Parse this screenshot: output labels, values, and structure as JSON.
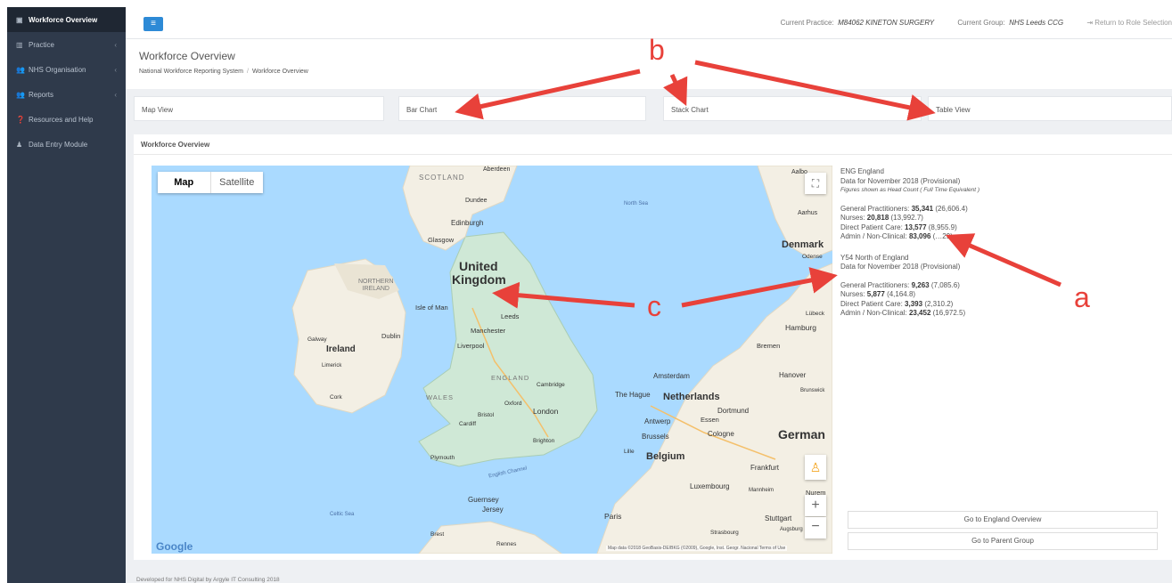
{
  "sidebar": {
    "items": [
      {
        "icon": "monitor-icon",
        "glyph": "▣",
        "label": "Workforce Overview",
        "chevron": ""
      },
      {
        "icon": "chart-icon",
        "glyph": "▥",
        "label": "Practice",
        "chevron": "‹"
      },
      {
        "icon": "users-icon",
        "glyph": "👥",
        "label": "NHS Organisation",
        "chevron": "‹"
      },
      {
        "icon": "users-icon",
        "glyph": "👥",
        "label": "Reports",
        "chevron": "‹"
      },
      {
        "icon": "help-icon",
        "glyph": "❓",
        "label": "Resources and Help",
        "chevron": ""
      },
      {
        "icon": "user-icon",
        "glyph": "♟",
        "label": "Data Entry Module",
        "chevron": ""
      }
    ]
  },
  "topbar": {
    "practice_label": "Current Practice:",
    "practice_value": "M84062 KINETON SURGERY",
    "group_label": "Current Group:",
    "group_value": "NHS Leeds CCG",
    "return_label": "Return to Role Selection"
  },
  "header": {
    "title": "Workforce Overview",
    "breadcrumb": [
      "National Workforce Reporting System",
      "Workforce Overview"
    ]
  },
  "tabs": [
    "Map View",
    "Bar Chart",
    "Stack Chart",
    "Table View"
  ],
  "panel": {
    "title": "Workforce Overview"
  },
  "map": {
    "toggle_map": "Map",
    "toggle_satellite": "Satellite",
    "zoom_in": "+",
    "zoom_out": "−",
    "google": "Google",
    "attribution": "Map data ©2018 GeoBasis-DE/BKG (©2009), Google, Inst. Geogr. Nacional  Terms of Use",
    "labels": {
      "scotland": "SCOTLAND",
      "aberdeen": "Aberdeen",
      "dundee": "Dundee",
      "edinburgh": "Edinburgh",
      "glasgow": "Glasgow",
      "north_sea": "North Sea",
      "united": "United",
      "kingdom": "Kingdom",
      "northern_ireland": "NORTHERN\nIRELAND",
      "isle_of_man": "Isle of Man",
      "leeds": "Leeds",
      "manchester": "Manchester",
      "liverpool": "Liverpool",
      "dublin": "Dublin",
      "galway": "Galway",
      "ireland": "Ireland",
      "limerick": "Limerick",
      "cork": "Cork",
      "wales": "WALES",
      "england": "ENGLAND",
      "cambridge": "Cambridge",
      "oxford": "Oxford",
      "london": "London",
      "bristol": "Bristol",
      "cardiff": "Cardiff",
      "brighton": "Brighton",
      "plymouth": "Plymouth",
      "english_channel": "English Channel",
      "guernsey": "Guernsey",
      "jersey": "Jersey",
      "celtic_sea": "Celtic Sea",
      "aalborg": "Aalbo",
      "aarhus": "Aarhus",
      "denmark": "Denmark",
      "odense": "Odense",
      "lubeck": "Lübeck",
      "hamburg": "Hamburg",
      "bremen": "Bremen",
      "amsterdam": "Amsterdam",
      "the_hague": "The Hague",
      "netherlands": "Netherlands",
      "hanover": "Hanover",
      "brunswick": "Brunswick",
      "dortmund": "Dortmund",
      "essen": "Essen",
      "antwerp": "Antwerp",
      "cologne": "Cologne",
      "brussels": "Brussels",
      "belgium": "Belgium",
      "germany": "German",
      "frankfurt": "Frankfurt",
      "luxembourg": "Luxembourg",
      "mannheim": "Mannheim",
      "nurem": "Nurem",
      "paris": "Paris",
      "stuttgart": "Stuttgart",
      "strasbourg": "Strasbourg",
      "augsburg": "Augsburg",
      "lille": "Lille",
      "brest": "Brest",
      "rennes": "Rennes"
    }
  },
  "info": {
    "eng": {
      "code": "ENG England",
      "period": "Data for November 2018 (Provisional)",
      "note": "Figures shown as Head Count ( Full Time Equivalent )",
      "rows": [
        {
          "label": "General Practitioners:",
          "hc": "35,341",
          "fte": "(26,606.4)"
        },
        {
          "label": "Nurses:",
          "hc": "20,818",
          "fte": "(13,992.7)"
        },
        {
          "label": "Direct Patient Care:",
          "hc": "13,577",
          "fte": "(8,955.9)"
        },
        {
          "label": "Admin / Non-Clinical:",
          "hc": "83,096",
          "fte": "(…29)"
        }
      ]
    },
    "y54": {
      "code": "Y54 North of England",
      "period": "Data for November 2018 (Provisional)",
      "rows": [
        {
          "label": "General Practitioners:",
          "hc": "9,263",
          "fte": "(7,085.6)"
        },
        {
          "label": "Nurses:",
          "hc": "5,877",
          "fte": "(4,164.8)"
        },
        {
          "label": "Direct Patient Care:",
          "hc": "3,393",
          "fte": "(2,310.2)"
        },
        {
          "label": "Admin / Non-Clinical:",
          "hc": "23,452",
          "fte": "(16,972.5)"
        }
      ]
    }
  },
  "buttons": {
    "england": "Go to England Overview",
    "parent": "Go to Parent Group"
  },
  "footer": "Developed for NHS Digital by Argyle IT Consulting 2018",
  "annotations": {
    "a": "a",
    "b": "b",
    "c": "c"
  },
  "colors": {
    "sidebar": "#2f3a4b",
    "accent": "#2d8ad6",
    "sea": "#aadaff",
    "land": "#f3efe4",
    "annotation": "#e8413a"
  }
}
